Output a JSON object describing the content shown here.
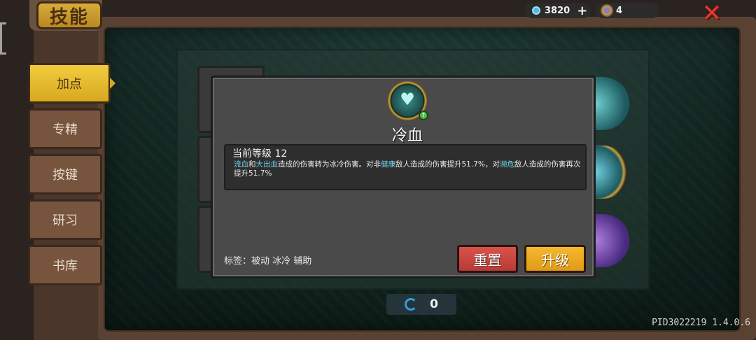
{
  "header": {
    "title": "技能"
  },
  "tabs": [
    {
      "label": "加点",
      "active": true
    },
    {
      "label": "专精",
      "active": false
    },
    {
      "label": "按键",
      "active": false
    },
    {
      "label": "研习",
      "active": false
    },
    {
      "label": "书库",
      "active": false
    }
  ],
  "currency": {
    "gems": "3820",
    "materials": "4"
  },
  "skill": {
    "name": "冷血",
    "level_text": "当前等级 12",
    "description": {
      "p1": "流血",
      "p2": "和",
      "p3": "大出血",
      "p4": "造成的伤害转为冰冷伤害。对非",
      "p5": "健康",
      "p6": "敌人造成的伤害提升51.7%，对",
      "p7": "濒危",
      "p8": "敌人造成的伤害再次提升51.7%"
    },
    "tags": "标签：被动 冰冷 辅助",
    "reset_label": "重置",
    "upgrade_label": "升级"
  },
  "skill_points": "0",
  "version": "PID3022219 1.4.0.6",
  "colors": {
    "keyword": "#6fd0e8",
    "reset_button": "#c7463e",
    "upgrade_button": "#eeaa22",
    "active_tab": "#e6b72e"
  }
}
